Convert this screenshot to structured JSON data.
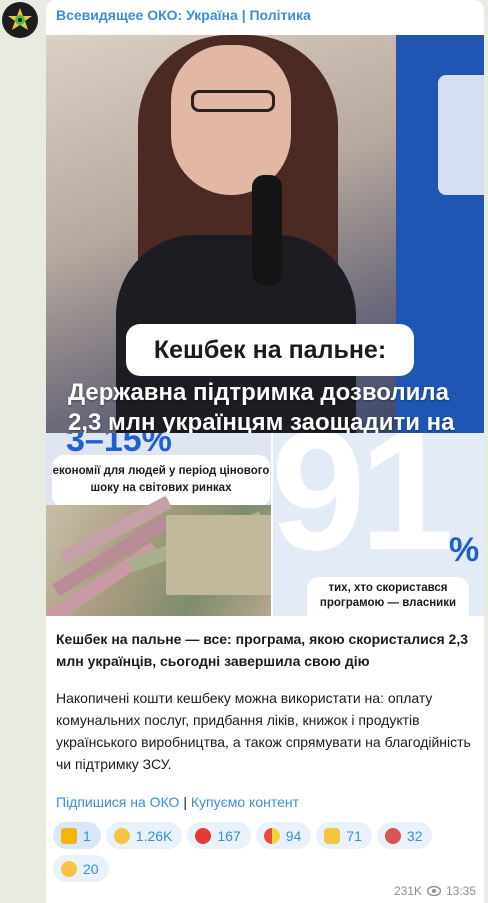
{
  "channel": {
    "name": "Всевидящее ОКО: Україна | Політика"
  },
  "post": {
    "image_main": {
      "title": "Кешбек на пальне:",
      "subtitle_line1": "Державна підтримка дозволила",
      "subtitle_line2": "2,3 млн українцям заощадити на"
    },
    "image_left": {
      "percent": "3–15%",
      "caption": "економії для людей у період цінового шоку на світових ринках"
    },
    "image_right": {
      "big_number": "91",
      "percent_sign": "%",
      "caption": "тих, хто скористався програмою — власники"
    },
    "title": "Кешбек на пальне — все: програма, якою скористалися 2,3 млн українців, сьогодні завершила свою дію",
    "body": "Накопичені кошти кешбеку можна використати на: оплату комунальних послуг, придбання ліків, книжок і продуктів українського виробництва, а також спрямувати на благодійність чи підтримку ЗСУ.",
    "links": {
      "subscribe": "Підпишися на ОКО",
      "separator": "|",
      "buy": "Купуємо контент"
    },
    "reactions": [
      {
        "icon": "star-icon",
        "count": "1",
        "active": true,
        "color": "#f4b400"
      },
      {
        "icon": "rofl-icon",
        "count": "1.26K",
        "color": "#f5c542"
      },
      {
        "icon": "heart-icon",
        "count": "167",
        "color": "#e53935"
      },
      {
        "icon": "pill-icon",
        "count": "94",
        "color": "#e74c3c"
      },
      {
        "icon": "thumbs-up-icon",
        "count": "71",
        "color": "#f5c542"
      },
      {
        "icon": "angry-face-icon",
        "count": "32",
        "color": "#d9534f"
      },
      {
        "icon": "sad-face-icon",
        "count": "20",
        "color": "#f5c542"
      }
    ],
    "views": "231K",
    "time": "13:35"
  }
}
